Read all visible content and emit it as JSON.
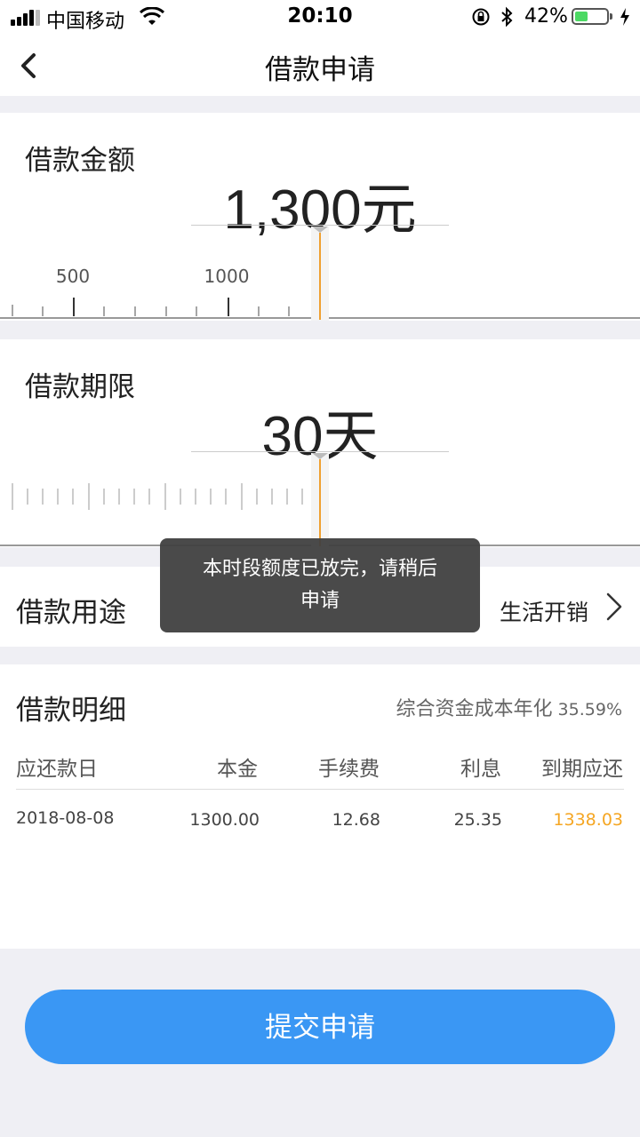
{
  "status_bar": {
    "carrier": "中国移动",
    "time": "20:10",
    "battery": "42%",
    "battery_level": 0.42
  },
  "nav": {
    "title": "借款申请",
    "back_icon": "chevron-left-icon"
  },
  "amount": {
    "label": "借款金额",
    "value": "1,300元",
    "tick_labels": [
      "500",
      "1000"
    ]
  },
  "term": {
    "label": "借款期限",
    "value": "30天"
  },
  "purpose": {
    "label": "借款用途",
    "value": "生活开销",
    "chevron_icon": "chevron-right-icon"
  },
  "toast": {
    "line1": "本时段额度已放完，请稍后",
    "line2": "申请"
  },
  "details": {
    "title": "借款明细",
    "rate_label": "综合资金成本年化",
    "rate_value": "35.59%",
    "columns": [
      "应还款日",
      "本金",
      "手续费",
      "利息",
      "到期应还"
    ],
    "rows": [
      [
        "2018-08-08",
        "1300.00",
        "12.68",
        "25.35",
        "1338.03"
      ]
    ]
  },
  "submit": {
    "label": "提交申请"
  },
  "colors": {
    "accent": "#3a97f4",
    "indicator": "#f0a030",
    "highlight": "#f5a623",
    "toast_bg": "#404040"
  }
}
